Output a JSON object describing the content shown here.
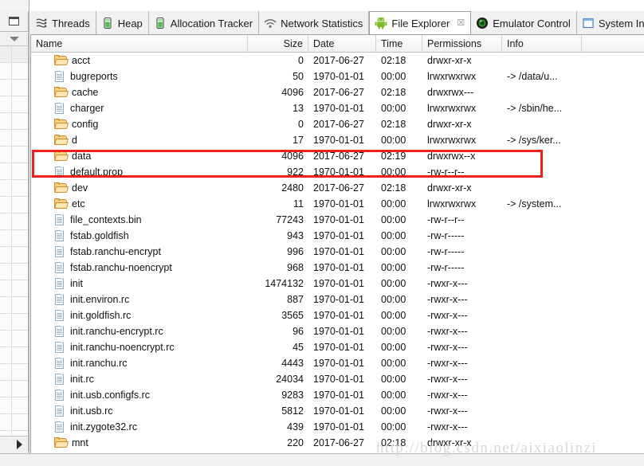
{
  "window": {
    "rail": {
      "restore_button_title": "Restore",
      "dropdown_title": "View Menu",
      "scroll_right_title": "Scroll Right"
    }
  },
  "tabs": [
    {
      "label": "Threads",
      "icon": "threads-icon",
      "active": false,
      "closable": false
    },
    {
      "label": "Heap",
      "icon": "heap-icon",
      "active": false,
      "closable": false
    },
    {
      "label": "Allocation Tracker",
      "icon": "allocation-tracker-icon",
      "active": false,
      "closable": false
    },
    {
      "label": "Network Statistics",
      "icon": "network-statistics-icon",
      "active": false,
      "closable": false
    },
    {
      "label": "File Explorer",
      "icon": "android-icon",
      "active": true,
      "closable": true,
      "close_glyph": "☒"
    },
    {
      "label": "Emulator Control",
      "icon": "emulator-control-icon",
      "active": false,
      "closable": false
    },
    {
      "label": "System Informatio",
      "icon": "system-information-icon",
      "active": false,
      "closable": false
    }
  ],
  "columns": [
    {
      "key": "name",
      "label": "Name",
      "align": "left"
    },
    {
      "key": "size",
      "label": "Size",
      "align": "right"
    },
    {
      "key": "date",
      "label": "Date",
      "align": "left"
    },
    {
      "key": "time",
      "label": "Time",
      "align": "left"
    },
    {
      "key": "permissions",
      "label": "Permissions",
      "align": "left"
    },
    {
      "key": "info",
      "label": "Info",
      "align": "left"
    }
  ],
  "rows": [
    {
      "name": "acct",
      "kind": "folder",
      "expandable": true,
      "size": "0",
      "date": "2017-06-27",
      "time": "02:18",
      "permissions": "drwxr-xr-x",
      "info": ""
    },
    {
      "name": "bugreports",
      "kind": "file",
      "expandable": false,
      "size": "50",
      "date": "1970-01-01",
      "time": "00:00",
      "permissions": "lrwxrwxrwx",
      "info": "-> /data/u..."
    },
    {
      "name": "cache",
      "kind": "folder",
      "expandable": true,
      "size": "4096",
      "date": "2017-06-27",
      "time": "02:18",
      "permissions": "drwxrwx---",
      "info": ""
    },
    {
      "name": "charger",
      "kind": "file",
      "expandable": false,
      "size": "13",
      "date": "1970-01-01",
      "time": "00:00",
      "permissions": "lrwxrwxrwx",
      "info": "-> /sbin/he..."
    },
    {
      "name": "config",
      "kind": "folder",
      "expandable": true,
      "size": "0",
      "date": "2017-06-27",
      "time": "02:18",
      "permissions": "drwxr-xr-x",
      "info": ""
    },
    {
      "name": "d",
      "kind": "folder",
      "expandable": false,
      "size": "17",
      "date": "1970-01-01",
      "time": "00:00",
      "permissions": "lrwxrwxrwx",
      "info": "-> /sys/ker..."
    },
    {
      "name": "data",
      "kind": "folder",
      "expandable": true,
      "size": "4096",
      "date": "2017-06-27",
      "time": "02:19",
      "permissions": "drwxrwx--x",
      "info": ""
    },
    {
      "name": "default.prop",
      "kind": "file",
      "expandable": false,
      "size": "922",
      "date": "1970-01-01",
      "time": "00:00",
      "permissions": "-rw-r--r--",
      "info": ""
    },
    {
      "name": "dev",
      "kind": "folder",
      "expandable": true,
      "size": "2480",
      "date": "2017-06-27",
      "time": "02:18",
      "permissions": "drwxr-xr-x",
      "info": ""
    },
    {
      "name": "etc",
      "kind": "folder",
      "expandable": false,
      "size": "11",
      "date": "1970-01-01",
      "time": "00:00",
      "permissions": "lrwxrwxrwx",
      "info": "-> /system..."
    },
    {
      "name": "file_contexts.bin",
      "kind": "file",
      "expandable": false,
      "size": "77243",
      "date": "1970-01-01",
      "time": "00:00",
      "permissions": "-rw-r--r--",
      "info": ""
    },
    {
      "name": "fstab.goldfish",
      "kind": "file",
      "expandable": false,
      "size": "943",
      "date": "1970-01-01",
      "time": "00:00",
      "permissions": "-rw-r-----",
      "info": ""
    },
    {
      "name": "fstab.ranchu-encrypt",
      "kind": "file",
      "expandable": false,
      "size": "996",
      "date": "1970-01-01",
      "time": "00:00",
      "permissions": "-rw-r-----",
      "info": ""
    },
    {
      "name": "fstab.ranchu-noencrypt",
      "kind": "file",
      "expandable": false,
      "size": "968",
      "date": "1970-01-01",
      "time": "00:00",
      "permissions": "-rw-r-----",
      "info": ""
    },
    {
      "name": "init",
      "kind": "file",
      "expandable": false,
      "size": "1474132",
      "date": "1970-01-01",
      "time": "00:00",
      "permissions": "-rwxr-x---",
      "info": ""
    },
    {
      "name": "init.environ.rc",
      "kind": "file",
      "expandable": false,
      "size": "887",
      "date": "1970-01-01",
      "time": "00:00",
      "permissions": "-rwxr-x---",
      "info": ""
    },
    {
      "name": "init.goldfish.rc",
      "kind": "file",
      "expandable": false,
      "size": "3565",
      "date": "1970-01-01",
      "time": "00:00",
      "permissions": "-rwxr-x---",
      "info": ""
    },
    {
      "name": "init.ranchu-encrypt.rc",
      "kind": "file",
      "expandable": false,
      "size": "96",
      "date": "1970-01-01",
      "time": "00:00",
      "permissions": "-rwxr-x---",
      "info": ""
    },
    {
      "name": "init.ranchu-noencrypt.rc",
      "kind": "file",
      "expandable": false,
      "size": "45",
      "date": "1970-01-01",
      "time": "00:00",
      "permissions": "-rwxr-x---",
      "info": ""
    },
    {
      "name": "init.ranchu.rc",
      "kind": "file",
      "expandable": false,
      "size": "4443",
      "date": "1970-01-01",
      "time": "00:00",
      "permissions": "-rwxr-x---",
      "info": ""
    },
    {
      "name": "init.rc",
      "kind": "file",
      "expandable": false,
      "size": "24034",
      "date": "1970-01-01",
      "time": "00:00",
      "permissions": "-rwxr-x---",
      "info": ""
    },
    {
      "name": "init.usb.configfs.rc",
      "kind": "file",
      "expandable": false,
      "size": "9283",
      "date": "1970-01-01",
      "time": "00:00",
      "permissions": "-rwxr-x---",
      "info": ""
    },
    {
      "name": "init.usb.rc",
      "kind": "file",
      "expandable": false,
      "size": "5812",
      "date": "1970-01-01",
      "time": "00:00",
      "permissions": "-rwxr-x---",
      "info": ""
    },
    {
      "name": "init.zygote32.rc",
      "kind": "file",
      "expandable": false,
      "size": "439",
      "date": "1970-01-01",
      "time": "00:00",
      "permissions": "-rwxr-x---",
      "info": ""
    },
    {
      "name": "mnt",
      "kind": "folder",
      "expandable": true,
      "size": "220",
      "date": "2017-06-27",
      "time": "02:18",
      "permissions": "drwxr-xr-x",
      "info": ""
    }
  ],
  "highlight": {
    "target_row_name": "data",
    "color": "#f01f1f"
  },
  "watermark": {
    "text": "http://blog.csdn.net/aixiaolinzi",
    "color": "#d8d8d8"
  }
}
